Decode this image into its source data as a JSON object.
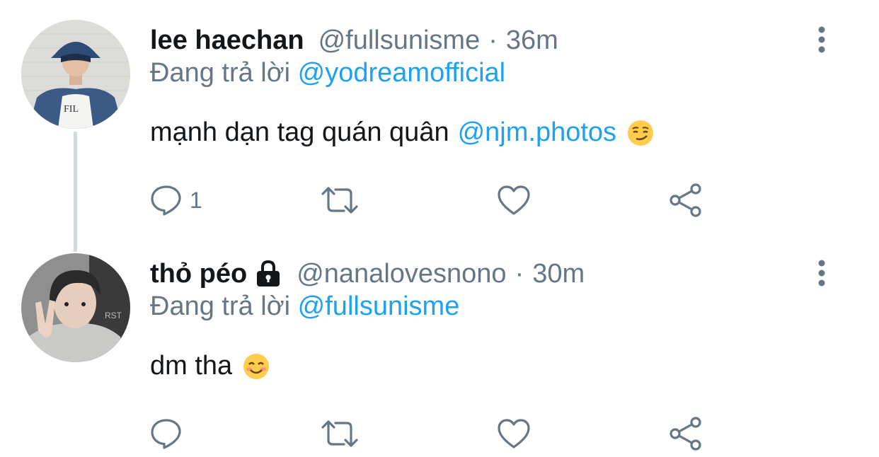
{
  "tweets": [
    {
      "display_name": "lee haechan",
      "handle": "@fullsunisme",
      "separator": "·",
      "time": "36m",
      "reply_prefix": "Đang trả lời",
      "reply_to": "@yodreamofficial",
      "text": "mạnh dạn tag quán quân",
      "text_mention": "@njm.photos",
      "emoji": "smirking-face",
      "reply_count": "1",
      "protected": false,
      "avatar_icon": "avatar-photo-bucket-hat"
    },
    {
      "display_name": "thỏ péo",
      "handle": "@nanalovesnono",
      "separator": "·",
      "time": "30m",
      "reply_prefix": "Đang trả lời",
      "reply_to": "@fullsunisme",
      "text": "dm tha",
      "emoji": "smiling-face-with-smiling-eyes",
      "reply_count": "",
      "protected": true,
      "avatar_icon": "avatar-photo-peace-sign"
    }
  ],
  "icons": {
    "reply": "comment-bubble-icon",
    "retweet": "retweet-icon",
    "like": "heart-icon",
    "share": "share-icon",
    "more": "more-vertical-icon",
    "lock": "lock-icon"
  },
  "colors": {
    "text": "#14171a",
    "secondary": "#657786",
    "link": "#1da1f2",
    "thread_line": "#cfd9de",
    "background": "#ffffff"
  }
}
